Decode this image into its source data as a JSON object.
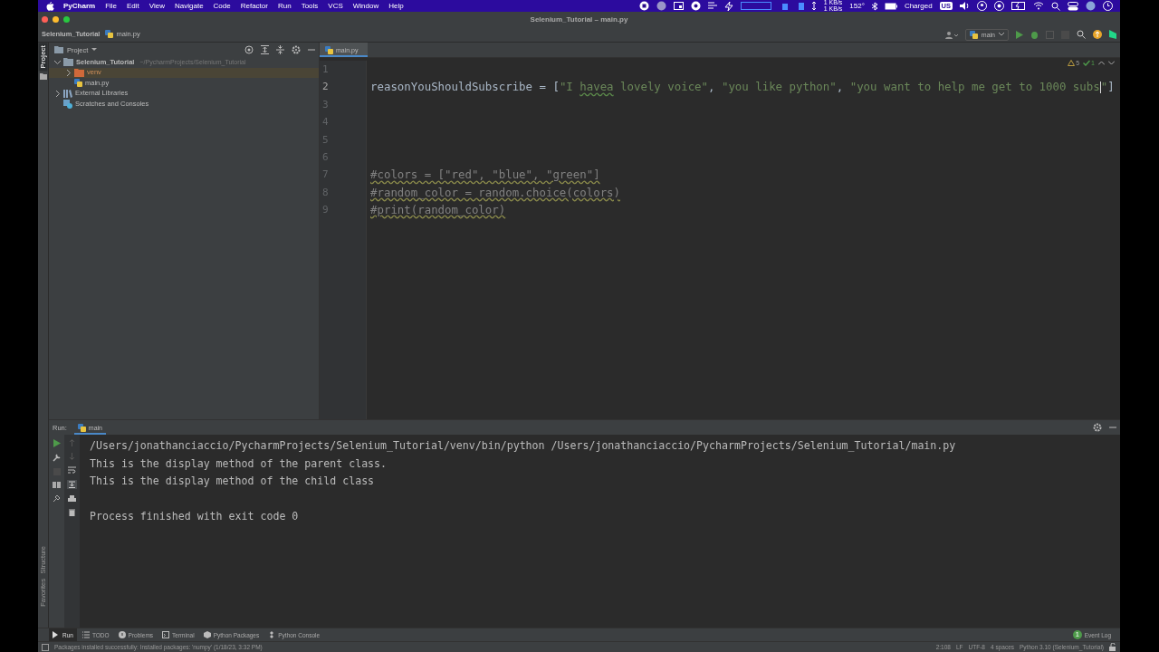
{
  "menubar": {
    "app": "PyCharm",
    "items": [
      "File",
      "Edit",
      "View",
      "Navigate",
      "Code",
      "Refactor",
      "Run",
      "Tools",
      "VCS",
      "Window",
      "Help"
    ],
    "net_up": "1 KB/s",
    "net_down": "1 KB/s",
    "temperature": "152°",
    "battery": "Charged",
    "input_source": "US"
  },
  "window": {
    "title": "Selenium_Tutorial – main.py"
  },
  "breadcrumb": [
    "Selenium_Tutorial",
    "main.py"
  ],
  "run_config": "main",
  "project": {
    "title": "Project",
    "tree": [
      {
        "name": "Selenium_Tutorial",
        "path": "~/PycharmProjects/Selenium_Tutorial",
        "kind": "project",
        "expanded": true,
        "children": [
          {
            "name": "venv",
            "kind": "excluded-folder",
            "expanded": false,
            "selected": true
          },
          {
            "name": "main.py",
            "kind": "python-file",
            "selected": false
          }
        ]
      },
      {
        "name": "External Libraries",
        "kind": "library",
        "expanded": false
      },
      {
        "name": "Scratches and Consoles",
        "kind": "scratch"
      }
    ]
  },
  "editor": {
    "tabs": [
      {
        "label": "main.py",
        "selected": true
      }
    ],
    "warnings": "5",
    "passed": "1",
    "lines": [
      {
        "number": "1"
      },
      {
        "number": "2",
        "tokens": [
          {
            "kind": "plain",
            "text": "reasonYouShouldSubscribe = ["
          },
          {
            "kind": "string",
            "text": "\"I "
          },
          {
            "kind": "typo",
            "text": "havea"
          },
          {
            "kind": "string",
            "text": " lovely voice\""
          },
          {
            "kind": "plain",
            "text": ", "
          },
          {
            "kind": "string",
            "text": "\"you like python\""
          },
          {
            "kind": "plain",
            "text": ", "
          },
          {
            "kind": "string",
            "text": "\"you want to help me get to 1000 subs"
          },
          {
            "kind": "caret"
          },
          {
            "kind": "string",
            "text": "\""
          },
          {
            "kind": "plain",
            "text": "]"
          }
        ]
      },
      {
        "number": "3"
      },
      {
        "number": "4"
      },
      {
        "number": "5"
      },
      {
        "number": "6"
      },
      {
        "number": "7",
        "tokens": [
          {
            "kind": "comment",
            "text": "#colors = [\"red\", \"blue\", \"green\"]"
          }
        ]
      },
      {
        "number": "8",
        "tokens": [
          {
            "kind": "comment",
            "text": "#random_color = random.choice(colors)"
          }
        ]
      },
      {
        "number": "9",
        "tokens": [
          {
            "kind": "comment",
            "text": "#print(random_color)"
          }
        ]
      }
    ]
  },
  "run_panel": {
    "label": "Run:",
    "tab": "main",
    "output": [
      {
        "text": "/Users/jonathanciaccio/PycharmProjects/Selenium_Tutorial/venv/bin/python /Users/jonathanciaccio/PycharmProjects/Selenium_Tutorial/main.py",
        "gap_before": false
      },
      {
        "text": "This is the display method of the parent class.",
        "gap_before": false
      },
      {
        "text": "This is the display method of the child class",
        "gap_before": false
      },
      {
        "text": "Process finished with exit code 0",
        "gap_before": true
      }
    ]
  },
  "tool_tabs": [
    {
      "label": "Run",
      "selected": true
    },
    {
      "label": "TODO",
      "selected": false
    },
    {
      "label": "Problems",
      "selected": false
    },
    {
      "label": "Terminal",
      "selected": false
    },
    {
      "label": "Python Packages",
      "selected": false
    },
    {
      "label": "Python Console",
      "selected": false
    }
  ],
  "event_log": {
    "label": "Event Log",
    "count": "1"
  },
  "side_tabs": [
    "Project",
    "Structure",
    "Favorites"
  ],
  "status_bar": {
    "message": "Packages installed successfully: Installed packages: 'numpy' (1/18/23, 3:32 PM)",
    "items": [
      "2:108",
      "LF",
      "UTF-8",
      "4 spaces",
      "Python 3.10 (Selenium_Tutorial)"
    ]
  }
}
